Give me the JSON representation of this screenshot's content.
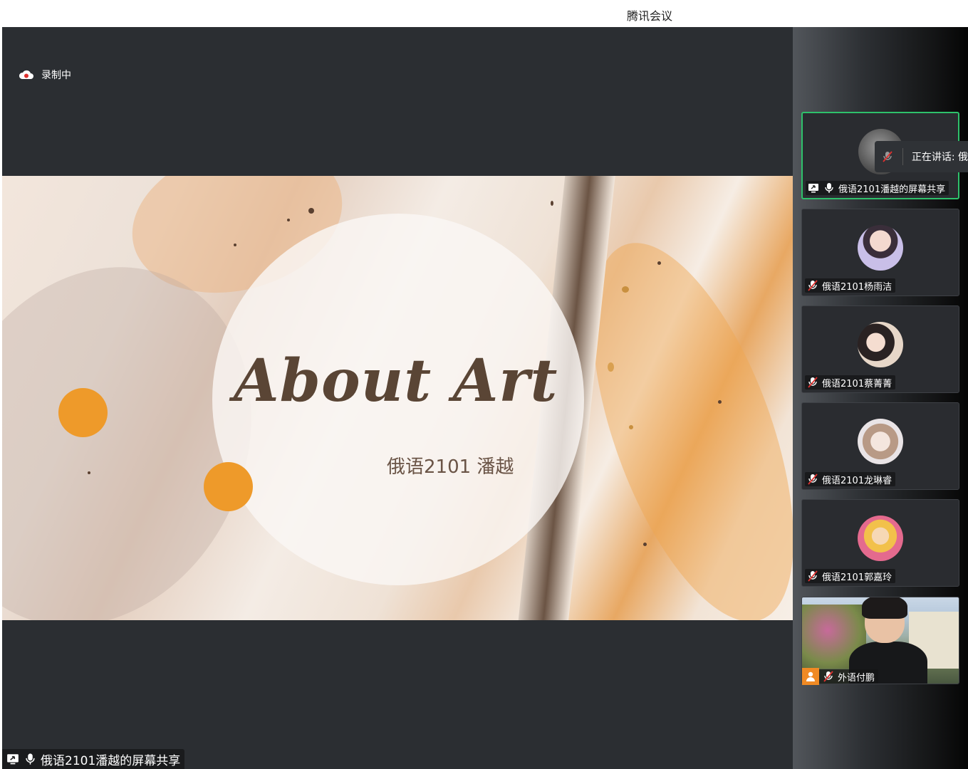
{
  "window": {
    "title": "腾讯会议"
  },
  "recording": {
    "label": "录制中"
  },
  "slide": {
    "heading": "About Art",
    "subtitle": "俄语2101 潘越"
  },
  "speaking": {
    "text": "正在讲话: 俄"
  },
  "tiles": [
    {
      "name": "俄语2101潘越的屏幕共享",
      "mic": "on",
      "screen_share": true,
      "active": true
    },
    {
      "name": "俄语2101杨雨洁",
      "mic": "muted"
    },
    {
      "name": "俄语2101蔡菁菁",
      "mic": "muted"
    },
    {
      "name": "俄语2101龙琳睿",
      "mic": "muted"
    },
    {
      "name": "俄语2101郭嘉玲",
      "mic": "muted"
    },
    {
      "name": "外语付鹏",
      "mic": "muted",
      "host": true,
      "video": true
    }
  ],
  "bottom_label": {
    "text": "俄语2101潘越的屏幕共享"
  },
  "colors": {
    "accent_green": "#2ec16b",
    "slide_orange": "#ee9a2a",
    "host_orange": "#f08a24",
    "background": "#2b2e32"
  },
  "icons": [
    "cloud-record-icon",
    "screen-share-icon",
    "mic-icon",
    "mic-muted-icon",
    "host-person-icon"
  ]
}
